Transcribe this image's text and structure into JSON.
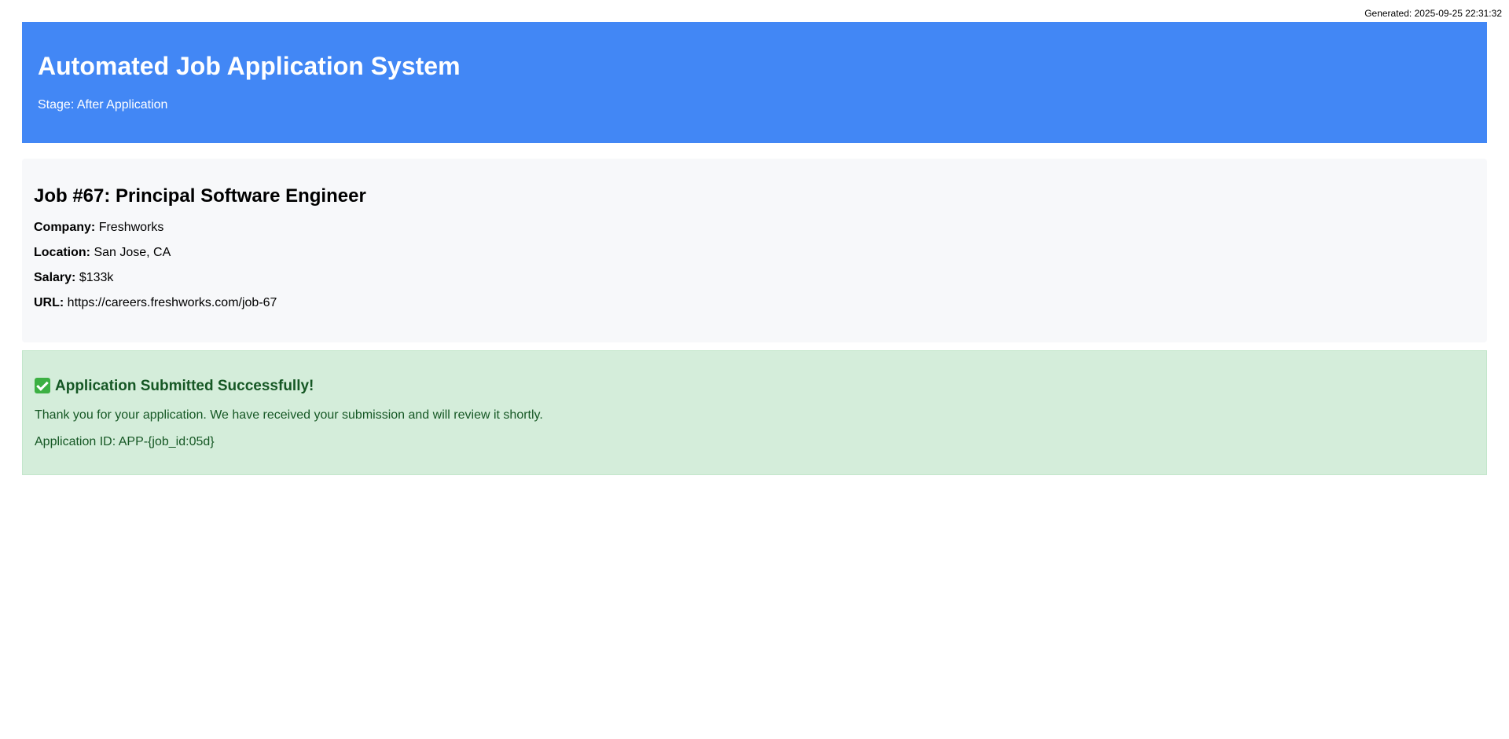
{
  "generated": "Generated: 2025-09-25 22:31:32",
  "header": {
    "title": "Automated Job Application System",
    "stage": "Stage: After Application"
  },
  "job": {
    "title": "Job #67: Principal Software Engineer",
    "company_label": "Company:",
    "company": "Freshworks",
    "location_label": "Location:",
    "location": "San Jose, CA",
    "salary_label": "Salary:",
    "salary": "$133k",
    "url_label": "URL:",
    "url": "https://careers.freshworks.com/job-67"
  },
  "success": {
    "icon": "check-mark-icon",
    "title": "Application Submitted Successfully!",
    "message": "Thank you for your application. We have received your submission and will review it shortly.",
    "application_id": "Application ID: APP-{job_id:05d}"
  },
  "colors": {
    "header_bg": "#4287f5",
    "card_bg": "#f7f8fa",
    "success_bg": "#d4edda",
    "success_text": "#155724"
  }
}
